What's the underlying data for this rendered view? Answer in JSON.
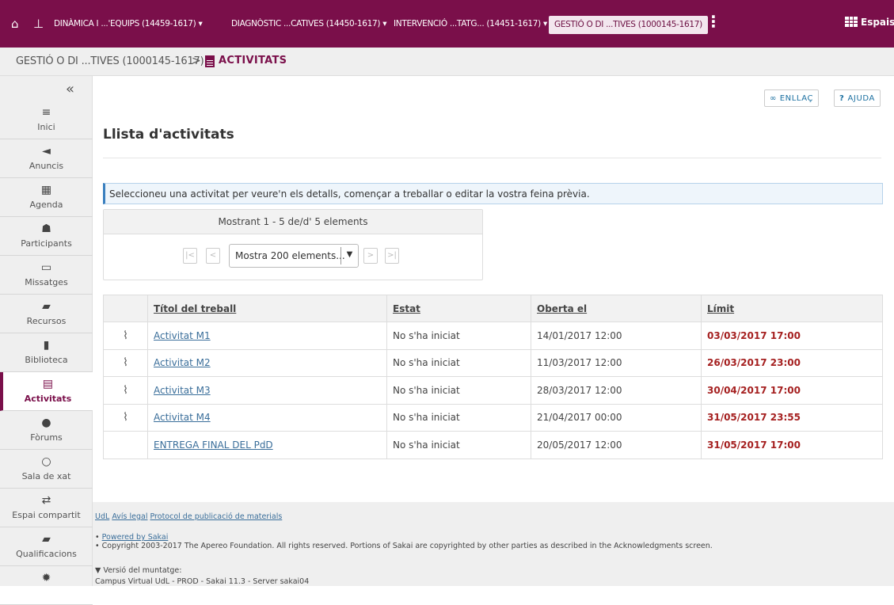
{
  "topbar": {
    "sites": [
      "DINÀMICA I ...'EQUIPS (14459-1617)",
      "DIAGNÒSTIC ...CATIVES (14450-1617)",
      "INTERVENCIÓ ...TATG... (14451-1617)"
    ],
    "current_site": "GESTIÓ O DI ...TIVES (1000145-1617)",
    "chevron": "▾",
    "more": "⋮",
    "espais_label": "Espais",
    "icons": [
      "home-icon",
      "sitemap-icon",
      "grid-icon"
    ]
  },
  "breadcrumb": {
    "site": "GESTIÓ O DI ...TIVES (1000145-1617)",
    "separator": ">",
    "tool": "ACTIVITATS"
  },
  "sidebar": {
    "collapse": "«",
    "items": [
      {
        "label": "Inici",
        "icon": "≡"
      },
      {
        "label": "Anuncis",
        "icon": "◄"
      },
      {
        "label": "Agenda",
        "icon": "▦"
      },
      {
        "label": "Participants",
        "icon": "☗"
      },
      {
        "label": "Missatges",
        "icon": "▭"
      },
      {
        "label": "Recursos",
        "icon": "▰"
      },
      {
        "label": "Biblioteca",
        "icon": "▮"
      },
      {
        "label": "Activitats",
        "icon": "▤",
        "active": true
      },
      {
        "label": "Fòrums",
        "icon": "●"
      },
      {
        "label": "Sala de xat",
        "icon": "○"
      },
      {
        "label": "Espai compartit",
        "icon": "⇄"
      },
      {
        "label": "Qualificacions",
        "icon": "▰"
      },
      {
        "label": "",
        "icon": "✹"
      }
    ]
  },
  "main": {
    "link_button": "ENLLAÇ",
    "help_button": "AJUDA",
    "title": "Llista d'activitats",
    "info": "Seleccioneu una activitat per veure'n els detalls, començar a treballar o editar la vostra feina prèvia.",
    "pager": {
      "summary": "Mostrant 1 - 5 de/d' 5 elements",
      "first": "|<",
      "prev": "<",
      "next": ">",
      "last": ">|",
      "page_size": "Mostra 200 elements...",
      "caret": "▼"
    },
    "table": {
      "headers": [
        "",
        "Títol del treball",
        "Estat",
        "Oberta el",
        "Límit"
      ],
      "rows": [
        {
          "attachment": true,
          "title": "Activitat M1",
          "status": "No s'ha iniciat",
          "open": "14/01/2017 12:00",
          "due": "03/03/2017 17:00"
        },
        {
          "attachment": true,
          "title": "Activitat M2",
          "status": "No s'ha iniciat",
          "open": "11/03/2017 12:00",
          "due": "26/03/2017 23:00"
        },
        {
          "attachment": true,
          "title": "Activitat M3",
          "status": "No s'ha iniciat",
          "open": "28/03/2017 12:00",
          "due": "30/04/2017 17:00"
        },
        {
          "attachment": true,
          "title": "Activitat M4",
          "status": "No s'ha iniciat",
          "open": "21/04/2017 00:00",
          "due": "31/05/2017 23:55"
        },
        {
          "attachment": false,
          "title": "ENTREGA FINAL DEL PdD",
          "status": "No s'ha iniciat",
          "open": "20/05/2017 12:00",
          "due": "31/05/2017 17:00"
        }
      ]
    }
  },
  "footer": {
    "links": [
      "UdL",
      "Avís legal",
      "Protocol de publicació de materials"
    ],
    "powered": "Powered by Sakai",
    "copyright": "Copyright 2003-2017 The Apereo Foundation. All rights reserved. Portions of Sakai are copyrighted by other parties as described in the Acknowledgments screen.",
    "version_label": "▼ Versió del muntatge:",
    "version_value": "Campus Virtual UdL - PROD - Sakai 11.3 - Server sakai04"
  },
  "colors": {
    "brand": "#7a0f4a",
    "due": "#a52020",
    "link": "#3a6e9a"
  }
}
